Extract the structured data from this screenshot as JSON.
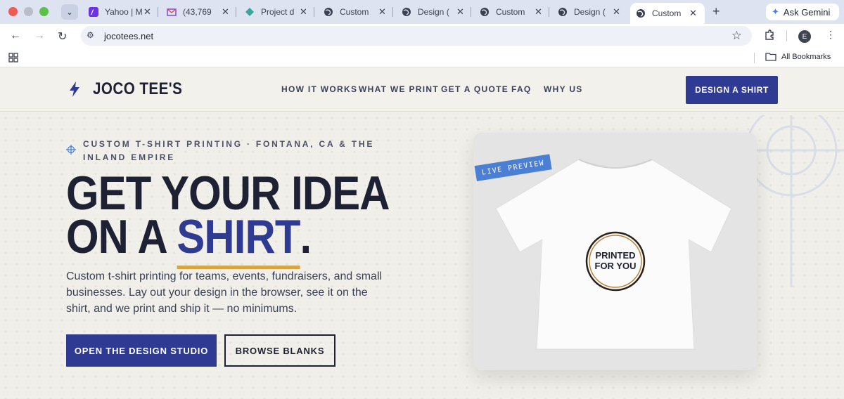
{
  "browser": {
    "tabs": [
      {
        "label": "Yahoo | M",
        "icon": "yahoo-icon"
      },
      {
        "label": "(43,769",
        "icon": "mail-icon"
      },
      {
        "label": "Project d",
        "icon": "diamond-icon"
      },
      {
        "label": "Custom",
        "icon": "globe-icon"
      },
      {
        "label": "Design (",
        "icon": "globe-icon"
      },
      {
        "label": "Custom",
        "icon": "globe-icon"
      },
      {
        "label": "Design (",
        "icon": "globe-icon"
      },
      {
        "label": "Custom",
        "icon": "globe-icon",
        "active": true
      }
    ],
    "gemini_label": "Ask Gemini",
    "url": "jocotees.net",
    "profile_initial": "E",
    "bookmarks_label": "All Bookmarks"
  },
  "site": {
    "logo": "JOCO TEE'S",
    "nav": [
      "HOW IT WORKS",
      "WHAT WE PRINT",
      "GET A QUOTE",
      "FAQ",
      "WHY US"
    ],
    "cta": "DESIGN A SHIRT",
    "eyebrow": "CUSTOM T-SHIRT PRINTING · FONTANA, CA & THE INLAND EMPIRE",
    "headline_line1": "GET YOUR IDEA",
    "headline_line2_prefix": "ON A ",
    "headline_accent": "SHIRT",
    "headline_suffix": ".",
    "lede": "Custom t-shirt printing for teams, events, fundraisers, and small businesses. Lay out your design in the browser, see it on the shirt, and we print and ship it — no minimums.",
    "primary_button": "OPEN THE DESIGN STUDIO",
    "secondary_button": "BROWSE BLANKS",
    "preview_badge": "LIVE PREVIEW",
    "shirt_print_line1": "PRINTED",
    "shirt_print_line2": "FOR YOU"
  },
  "colors": {
    "brand": "#2f3a92",
    "accent_underline": "#d7a448",
    "badge": "#4a7fd4",
    "ink": "#1d2133"
  }
}
